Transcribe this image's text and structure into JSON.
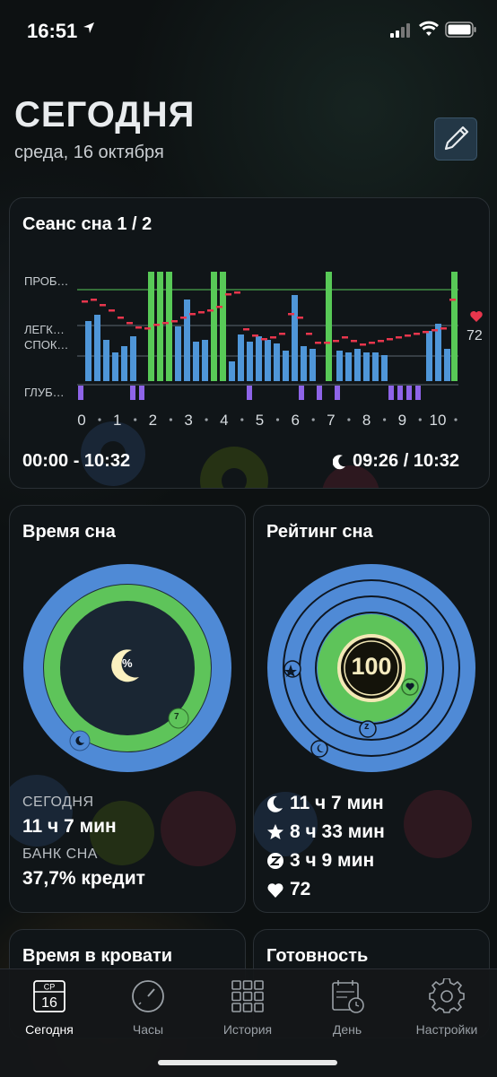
{
  "status_bar": {
    "time": "16:51"
  },
  "header": {
    "title": "СЕГОДНЯ",
    "date": "среда, 16 октября"
  },
  "session_card": {
    "title": "Сеанс сна 1 / 2",
    "stage_labels": [
      "ПРОБ…",
      "ЛЕГК…",
      "СПОК…",
      "ГЛУБ…"
    ],
    "hour_ticks": [
      "0",
      "1",
      "2",
      "3",
      "4",
      "5",
      "6",
      "7",
      "8",
      "9",
      "10"
    ],
    "heart_rate": "72",
    "time_range": "00:00 - 10:32",
    "sleep_ratio": "09:26 / 10:32"
  },
  "sleep_time_card": {
    "title": "Время сна",
    "center_symbol": "%",
    "badge_number": "7",
    "today_label": "СЕГОДНЯ",
    "today_value": "11 ч 7 мин",
    "bank_label": "БАНК СНА",
    "bank_value": "37,7% кредит"
  },
  "rating_card": {
    "title": "Рейтинг сна",
    "score": "100",
    "badge_z": "z",
    "stats": [
      {
        "icon": "moon-icon",
        "value": "11 ч 7 мин"
      },
      {
        "icon": "star-icon",
        "value": "8 ч 33 мин"
      },
      {
        "icon": "z-icon",
        "value": "3 ч 9 мин"
      },
      {
        "icon": "heart-icon",
        "value": "72"
      }
    ]
  },
  "bed_card": {
    "title": "Время в кровати"
  },
  "readiness_card": {
    "title": "Готовность"
  },
  "tabbar": {
    "calendar_weekday": "СР",
    "calendar_day": "16",
    "tabs": [
      {
        "label": "Сегодня",
        "icon": "calendar-icon",
        "active": true
      },
      {
        "label": "Часы",
        "icon": "gauge-icon",
        "active": false
      },
      {
        "label": "История",
        "icon": "grid-icon",
        "active": false
      },
      {
        "label": "День",
        "icon": "day-calendar-icon",
        "active": false
      },
      {
        "label": "Настройки",
        "icon": "gear-icon",
        "active": false
      }
    ]
  },
  "colors": {
    "awake": "#58c957",
    "light": "#4f96d8",
    "deep": "#8e64e8",
    "hr": "#e8364d",
    "accent": "#5aa0e0"
  }
}
